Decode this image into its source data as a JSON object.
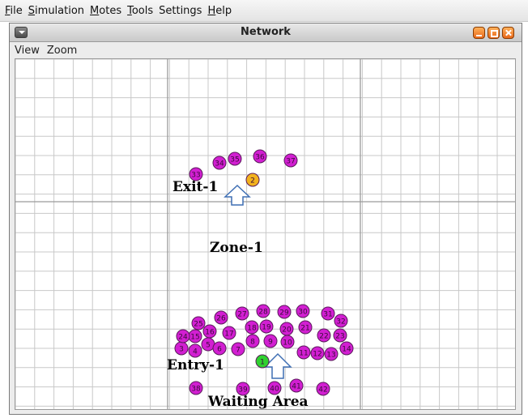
{
  "menubar": {
    "items": [
      {
        "mnemonic": "F",
        "rest": "ile"
      },
      {
        "mnemonic": "S",
        "rest": "imulation"
      },
      {
        "mnemonic": "M",
        "rest": "otes"
      },
      {
        "mnemonic": "T",
        "rest": "ools"
      },
      {
        "mnemonic": "",
        "rest": "Settings"
      },
      {
        "mnemonic": "H",
        "rest": "elp"
      }
    ]
  },
  "window": {
    "title": "Network",
    "menu_icon": "window-menu-icon",
    "buttons": [
      "minimize",
      "maximize",
      "close"
    ],
    "button_color": "#f0802a",
    "inner_menu": [
      "View",
      "Zoom"
    ]
  },
  "network": {
    "labels": {
      "exit": "Exit-1",
      "zone": "Zone-1",
      "entry": "Entry-1",
      "waiting": "Waiting Area"
    },
    "colors": {
      "mote_default": "#d21fd2",
      "mote_exit": "#f2b21e",
      "mote_entry": "#2fd12f",
      "grid": "#c8c8c8",
      "grid_major": "#9a9a9a",
      "arrow": "#3f6fb4"
    },
    "motes_exit_group": [
      {
        "id": "2",
        "type": "exit"
      },
      {
        "id": "33"
      },
      {
        "id": "34"
      },
      {
        "id": "35"
      },
      {
        "id": "36"
      },
      {
        "id": "37"
      }
    ],
    "motes_entry_group": [
      {
        "id": "1",
        "type": "entry"
      },
      {
        "id": "3"
      },
      {
        "id": "4"
      },
      {
        "id": "5"
      },
      {
        "id": "6"
      },
      {
        "id": "7"
      },
      {
        "id": "8"
      },
      {
        "id": "9"
      },
      {
        "id": "10"
      },
      {
        "id": "11"
      },
      {
        "id": "12"
      },
      {
        "id": "13"
      },
      {
        "id": "14"
      },
      {
        "id": "15"
      },
      {
        "id": "16"
      },
      {
        "id": "17"
      },
      {
        "id": "18"
      },
      {
        "id": "19"
      },
      {
        "id": "20"
      },
      {
        "id": "21"
      },
      {
        "id": "22"
      },
      {
        "id": "23"
      },
      {
        "id": "24"
      },
      {
        "id": "25"
      },
      {
        "id": "26"
      },
      {
        "id": "27"
      },
      {
        "id": "28"
      },
      {
        "id": "29"
      },
      {
        "id": "30"
      },
      {
        "id": "31"
      },
      {
        "id": "32"
      }
    ],
    "motes_waiting_group": [
      {
        "id": "38"
      },
      {
        "id": "39"
      },
      {
        "id": "40"
      },
      {
        "id": "41"
      },
      {
        "id": "42"
      }
    ]
  }
}
